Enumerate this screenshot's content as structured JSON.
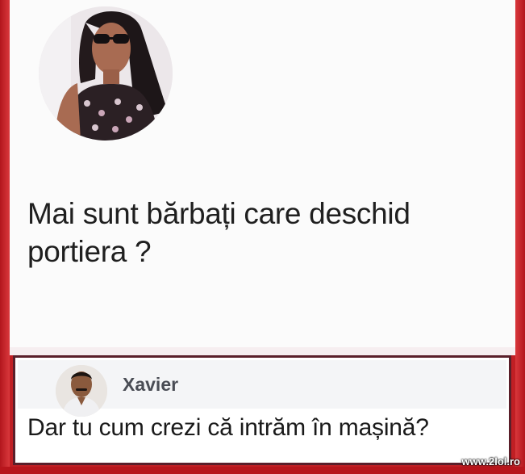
{
  "post": {
    "text_line1": "Mai sunt bărbați care deschid",
    "text_line2": "portiera ?"
  },
  "comment": {
    "author": "Xavier",
    "text": "Dar tu cum crezi că intrăm în mașină?"
  },
  "watermark": "www.2lol.ro",
  "colors": {
    "frame": "#c01f24",
    "card_bg": "#fbfbfb",
    "comment_border": "#5a1f2a",
    "name_color": "#4a4d55"
  },
  "icons": {
    "post_avatar": "profile-photo-woman-sunglasses",
    "comment_avatar": "profile-photo-man-mustache"
  }
}
